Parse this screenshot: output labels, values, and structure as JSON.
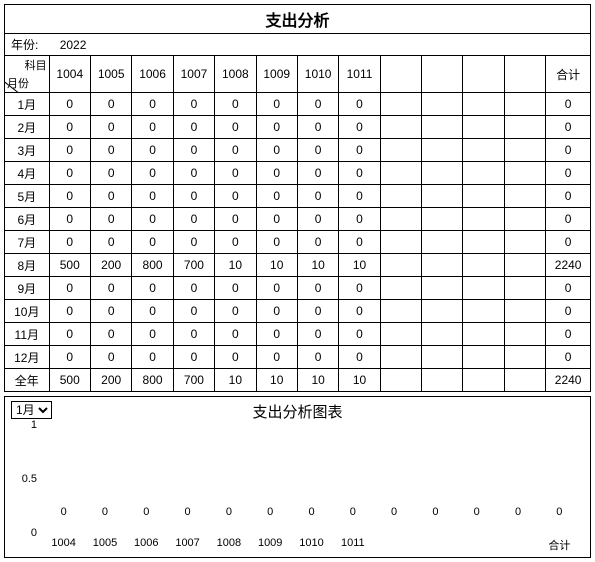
{
  "title": "支出分析",
  "year_label": "年份:",
  "year_value": "2022",
  "corner": {
    "top": "科目",
    "bottom": "月份"
  },
  "subjects": [
    "1004",
    "1005",
    "1006",
    "1007",
    "1008",
    "1009",
    "1010",
    "1011",
    "",
    "",
    "",
    ""
  ],
  "sum_label": "合计",
  "months": [
    "1月",
    "2月",
    "3月",
    "4月",
    "5月",
    "6月",
    "7月",
    "8月",
    "9月",
    "10月",
    "11月",
    "12月"
  ],
  "year_total_label": "全年",
  "values": [
    [
      0,
      0,
      0,
      0,
      0,
      0,
      0,
      0,
      "",
      "",
      "",
      ""
    ],
    [
      0,
      0,
      0,
      0,
      0,
      0,
      0,
      0,
      "",
      "",
      "",
      ""
    ],
    [
      0,
      0,
      0,
      0,
      0,
      0,
      0,
      0,
      "",
      "",
      "",
      ""
    ],
    [
      0,
      0,
      0,
      0,
      0,
      0,
      0,
      0,
      "",
      "",
      "",
      ""
    ],
    [
      0,
      0,
      0,
      0,
      0,
      0,
      0,
      0,
      "",
      "",
      "",
      ""
    ],
    [
      0,
      0,
      0,
      0,
      0,
      0,
      0,
      0,
      "",
      "",
      "",
      ""
    ],
    [
      0,
      0,
      0,
      0,
      0,
      0,
      0,
      0,
      "",
      "",
      "",
      ""
    ],
    [
      500,
      200,
      800,
      700,
      10,
      10,
      10,
      10,
      "",
      "",
      "",
      ""
    ],
    [
      0,
      0,
      0,
      0,
      0,
      0,
      0,
      0,
      "",
      "",
      "",
      ""
    ],
    [
      0,
      0,
      0,
      0,
      0,
      0,
      0,
      0,
      "",
      "",
      "",
      ""
    ],
    [
      0,
      0,
      0,
      0,
      0,
      0,
      0,
      0,
      "",
      "",
      "",
      ""
    ],
    [
      0,
      0,
      0,
      0,
      0,
      0,
      0,
      0,
      "",
      "",
      "",
      ""
    ]
  ],
  "row_totals": [
    0,
    0,
    0,
    0,
    0,
    0,
    0,
    2240,
    0,
    0,
    0,
    0
  ],
  "col_totals": [
    500,
    200,
    800,
    700,
    10,
    10,
    10,
    10,
    "",
    "",
    "",
    ""
  ],
  "grand_total": 2240,
  "chart_title": "支出分析图表",
  "selected_month": "1月",
  "chart_data": {
    "type": "bar",
    "title": "支出分析图表",
    "categories": [
      "1004",
      "1005",
      "1006",
      "1007",
      "1008",
      "1009",
      "1010",
      "1011",
      "",
      "",
      "",
      "",
      "合计"
    ],
    "values": [
      0,
      0,
      0,
      0,
      0,
      0,
      0,
      0,
      0,
      0,
      0,
      0,
      0
    ],
    "ylim": [
      0,
      1
    ],
    "yticks": [
      0,
      0.5,
      1
    ],
    "xlabel": "",
    "ylabel": ""
  }
}
